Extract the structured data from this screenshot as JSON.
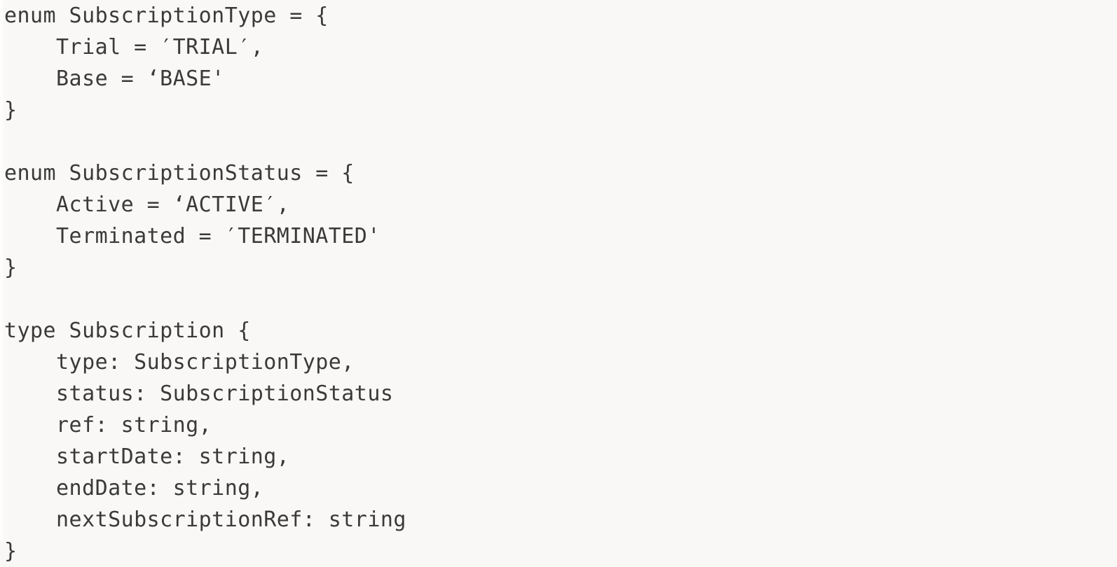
{
  "document": {
    "kind": "code-snippet",
    "language": "typescript-like schema",
    "background_color": "#f9f8f6",
    "edge_strip_color": "#fdfdfc",
    "text_color": "#3a3a3a"
  },
  "code": {
    "lines": [
      "enum SubscriptionType = {",
      "    Trial = ′TRIAL′,",
      "    Base = ‘BASE'",
      "}",
      "",
      "enum SubscriptionStatus = {",
      "    Active = ‘ACTIVE′,",
      "    Terminated = ′TERMINATED'",
      "}",
      "",
      "type Subscription {",
      "    type: SubscriptionType,",
      "    status: SubscriptionStatus",
      "    ref: string,",
      "    startDate: string,",
      "    endDate: string,",
      "    nextSubscriptionRef: string",
      "}"
    ],
    "blocks": [
      {
        "name": "SubscriptionType",
        "keyword": "enum",
        "members": [
          {
            "key": "Trial",
            "value": "TRIAL"
          },
          {
            "key": "Base",
            "value": "BASE"
          }
        ]
      },
      {
        "name": "SubscriptionStatus",
        "keyword": "enum",
        "members": [
          {
            "key": "Active",
            "value": "ACTIVE"
          },
          {
            "key": "Terminated",
            "value": "TERMINATED"
          }
        ]
      },
      {
        "name": "Subscription",
        "keyword": "type",
        "fields": [
          {
            "key": "type",
            "type": "SubscriptionType",
            "trailing_comma": true
          },
          {
            "key": "status",
            "type": "SubscriptionStatus",
            "trailing_comma": false
          },
          {
            "key": "ref",
            "type": "string",
            "trailing_comma": true
          },
          {
            "key": "startDate",
            "type": "string",
            "trailing_comma": true
          },
          {
            "key": "endDate",
            "type": "string",
            "trailing_comma": true
          },
          {
            "key": "nextSubscriptionRef",
            "type": "string",
            "trailing_comma": false
          }
        ]
      }
    ]
  }
}
